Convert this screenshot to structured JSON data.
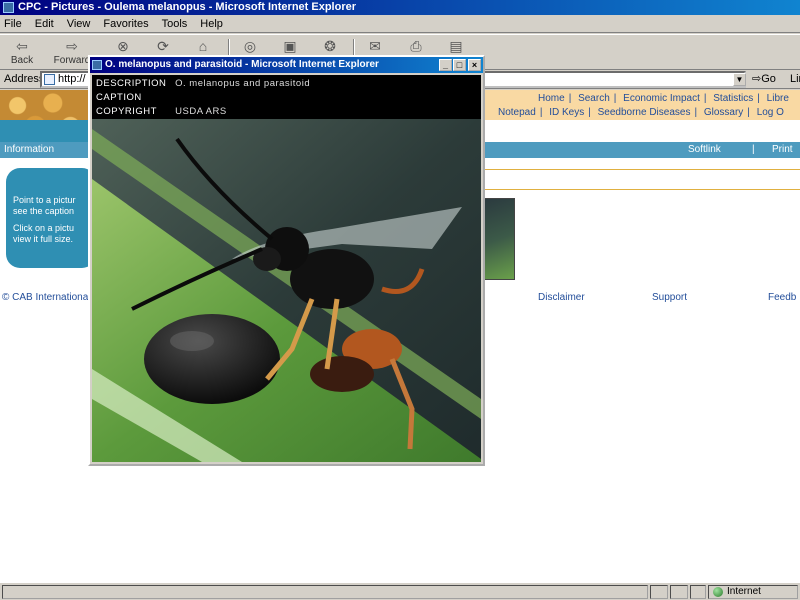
{
  "window": {
    "title": "CPC - Pictures - Oulema melanopus - Microsoft Internet Explorer"
  },
  "menu": [
    "File",
    "Edit",
    "View",
    "Favorites",
    "Tools",
    "Help"
  ],
  "toolbar": {
    "back": "Back",
    "forward": "Forward"
  },
  "address": {
    "label": "Address",
    "value": "http://",
    "go": "Go",
    "links": "Links"
  },
  "site": {
    "nav_row1": [
      "Home",
      "Search",
      "Economic Impact",
      "Statistics",
      "Libre"
    ],
    "nav_row2": [
      "Notepad",
      "ID Keys",
      "Seedborne Diseases",
      "Glossary",
      "Log O"
    ],
    "info_label": "Information",
    "softlink": "Softlink",
    "print_sep": "|",
    "print": "Print",
    "help_lines": [
      "Point to a pictur",
      "see the caption",
      "Click on a pictu",
      "view it full size."
    ],
    "footer": {
      "copyright": "© CAB International",
      "disclaimer": "Disclaimer",
      "support": "Support",
      "feedback": "Feedb"
    }
  },
  "popup": {
    "title": "O. melanopus and parasitoid - Microsoft Internet Explorer",
    "description_label": "DESCRIPTION",
    "description_value": "O. melanopus and parasitoid",
    "caption_label": "CAPTION",
    "caption_value": "",
    "copyright_label": "COPYRIGHT",
    "copyright_value": "USDA ARS"
  },
  "statusbar": {
    "zone": "Internet"
  }
}
